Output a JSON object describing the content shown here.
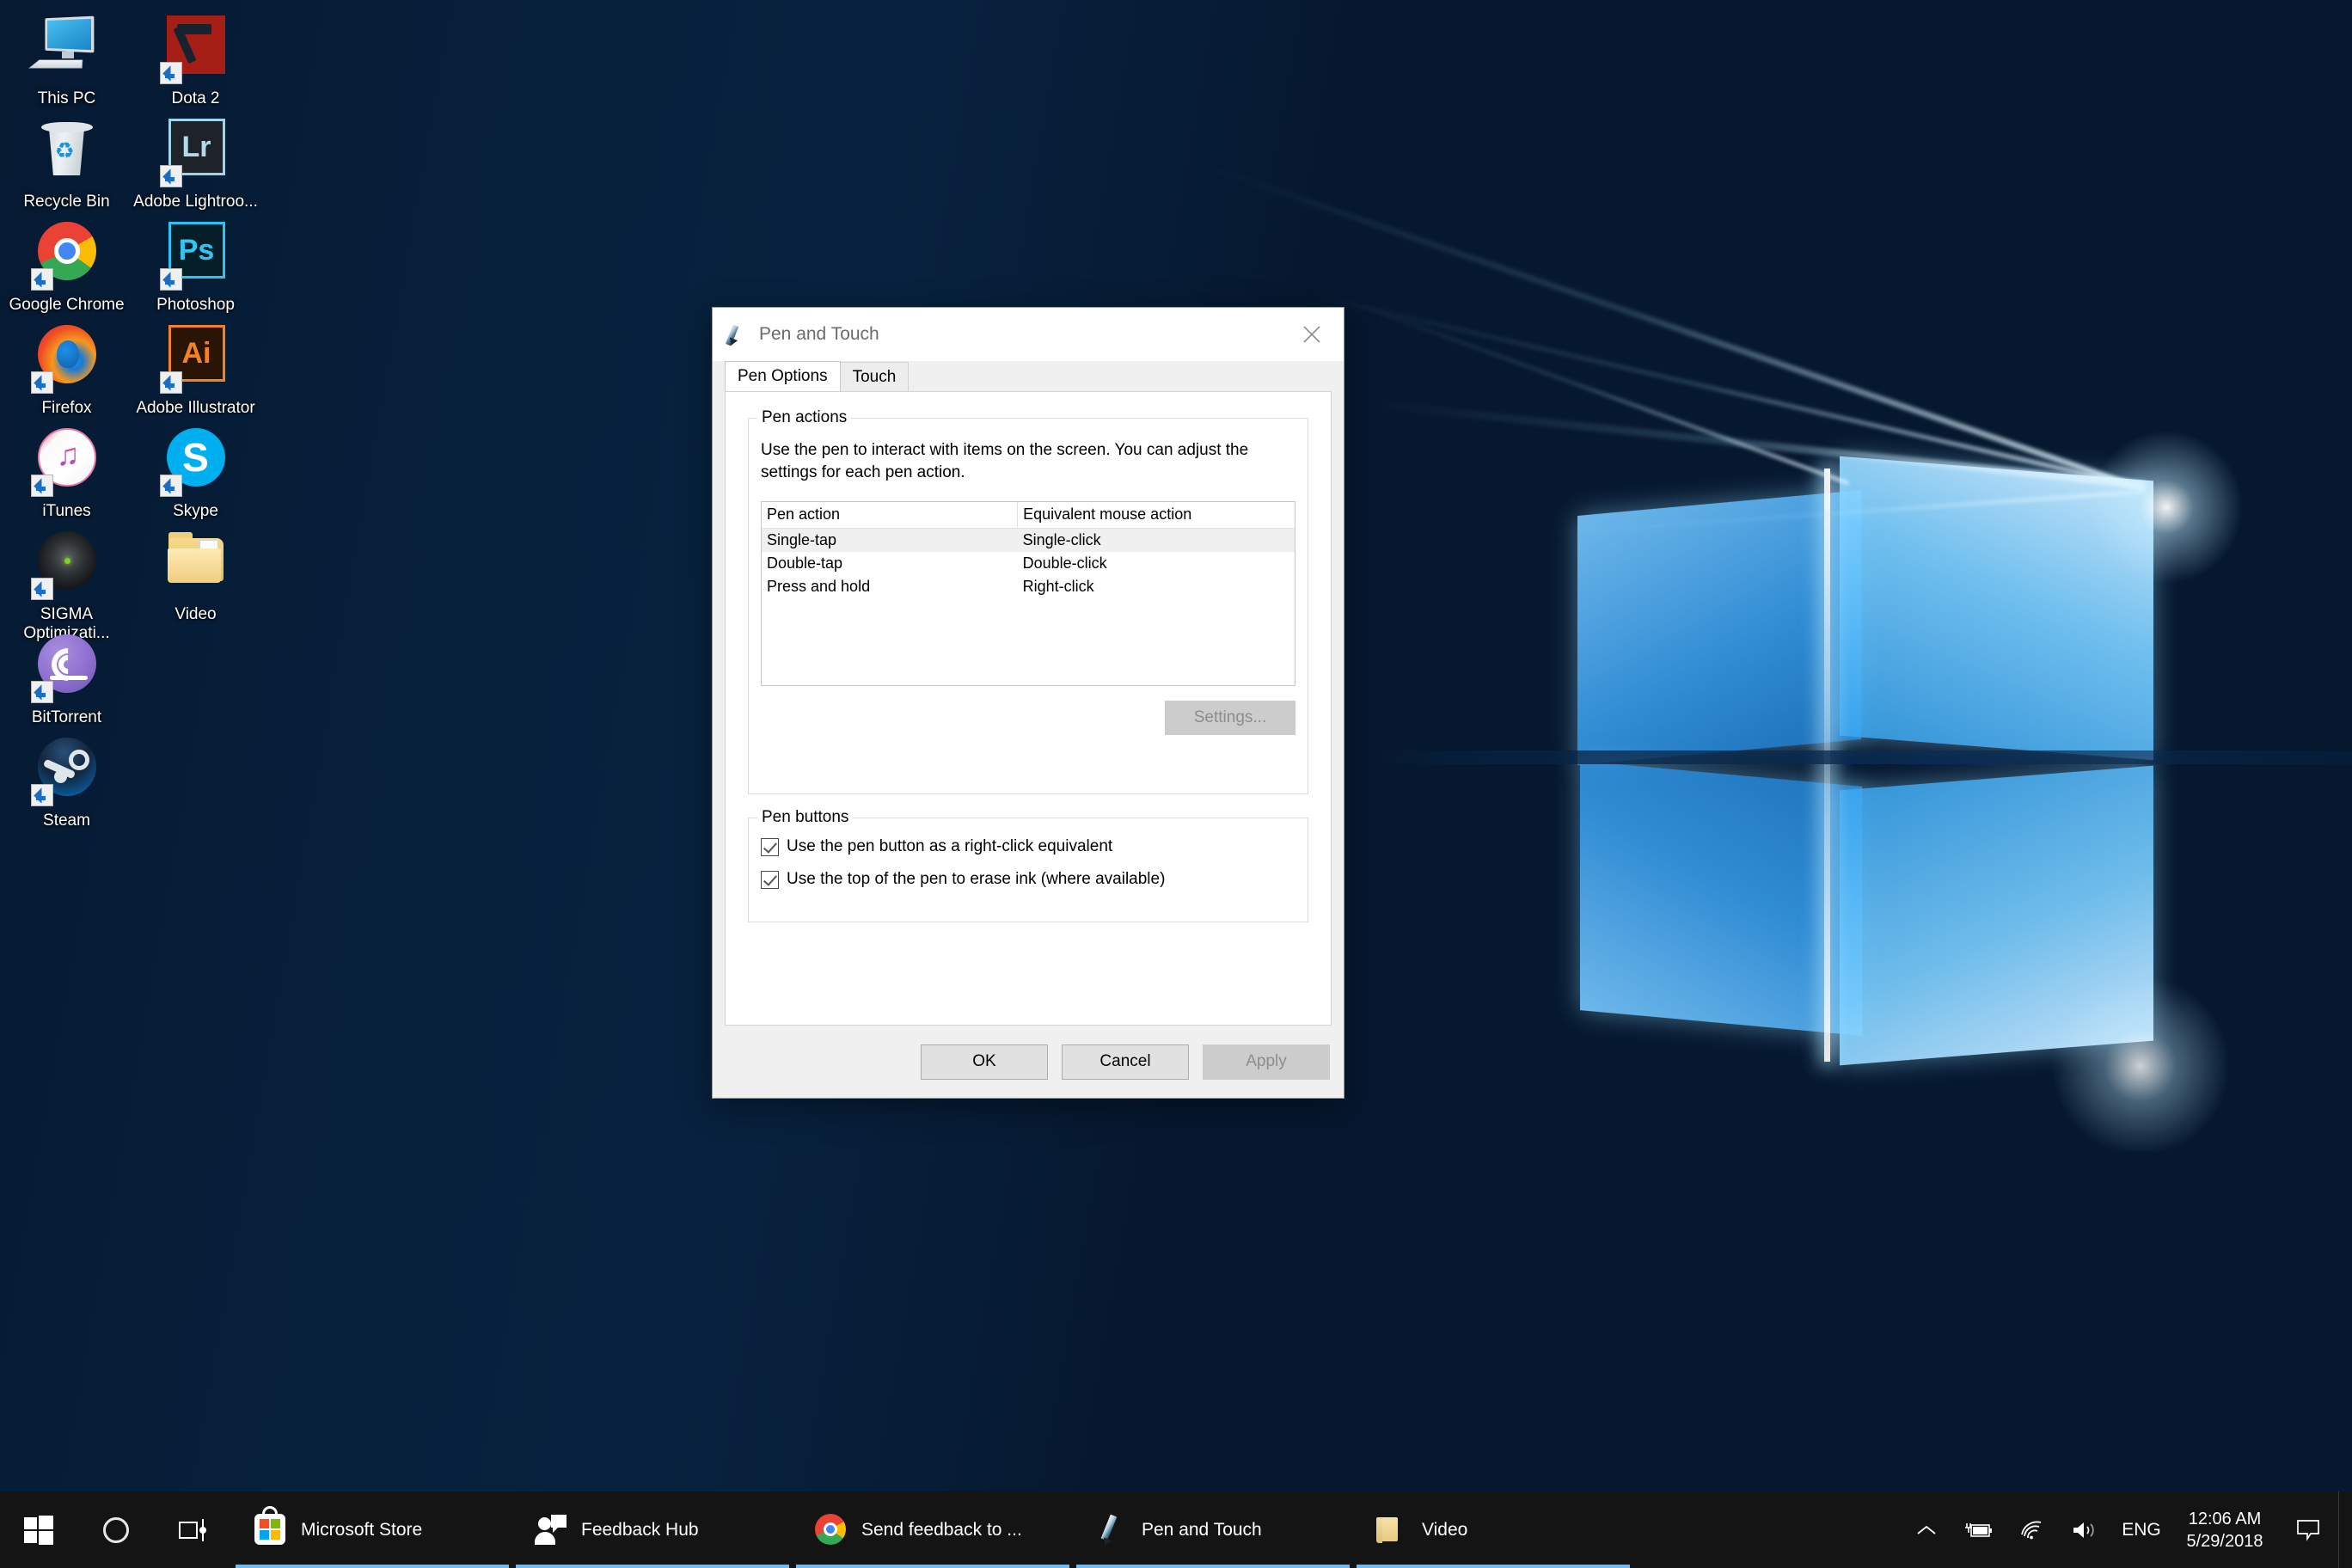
{
  "desktop": {
    "icons": [
      {
        "label": "This PC",
        "icon": "this-pc-icon",
        "shortcut": false
      },
      {
        "label": "Dota 2",
        "icon": "dota-2-icon",
        "shortcut": true
      },
      {
        "label": "Recycle Bin",
        "icon": "recycle-bin-icon",
        "shortcut": false
      },
      {
        "label": "Adobe Lightroo...",
        "icon": "adobe-lightroom-icon",
        "shortcut": true
      },
      {
        "label": "Google Chrome",
        "icon": "google-chrome-icon",
        "shortcut": true
      },
      {
        "label": "Photoshop",
        "icon": "adobe-photoshop-icon",
        "shortcut": true
      },
      {
        "label": "Firefox",
        "icon": "firefox-icon",
        "shortcut": true
      },
      {
        "label": "Adobe Illustrator ...",
        "icon": "adobe-illustrator-icon",
        "shortcut": true
      },
      {
        "label": "iTunes",
        "icon": "itunes-icon",
        "shortcut": true
      },
      {
        "label": "Skype",
        "icon": "skype-icon",
        "shortcut": true
      },
      {
        "label": "SIGMA Optimizati...",
        "icon": "sigma-optimization-icon",
        "shortcut": true
      },
      {
        "label": "Video",
        "icon": "folder-icon",
        "shortcut": false
      },
      {
        "label": "BitTorrent",
        "icon": "bittorrent-icon",
        "shortcut": true
      },
      {
        "label": "Steam",
        "icon": "steam-icon",
        "shortcut": true
      }
    ]
  },
  "dialog": {
    "title": "Pen and Touch",
    "title_icon": "pen-icon",
    "close_icon": "close-icon",
    "tabs": [
      {
        "label": "Pen Options",
        "active": true
      },
      {
        "label": "Touch",
        "active": false
      }
    ],
    "pen_actions": {
      "group_title": "Pen actions",
      "description": "Use the pen to interact with items on the screen.  You can adjust the settings for each pen action.",
      "columns": [
        "Pen action",
        "Equivalent mouse action"
      ],
      "rows": [
        {
          "action": "Single-tap",
          "mouse": "Single-click",
          "selected": true
        },
        {
          "action": "Double-tap",
          "mouse": "Double-click",
          "selected": false
        },
        {
          "action": "Press and hold",
          "mouse": "Right-click",
          "selected": false
        }
      ],
      "settings_button": "Settings...",
      "settings_disabled": true
    },
    "pen_buttons": {
      "group_title": "Pen buttons",
      "checkboxes": [
        {
          "label": "Use the pen button as a right-click equivalent",
          "checked": true
        },
        {
          "label": "Use the top of the pen to erase ink (where available)",
          "checked": true
        }
      ]
    },
    "buttons": [
      {
        "label": "OK",
        "disabled": false
      },
      {
        "label": "Cancel",
        "disabled": false
      },
      {
        "label": "Apply",
        "disabled": true
      }
    ]
  },
  "taskbar": {
    "start_icon": "windows-start-icon",
    "cortana_icon": "cortana-search-icon",
    "taskview_icon": "task-view-icon",
    "apps": [
      {
        "label": "Microsoft Store",
        "icon": "microsoft-store-icon",
        "active": true
      },
      {
        "label": "Feedback Hub",
        "icon": "feedback-hub-icon",
        "active": true
      },
      {
        "label": "Send feedback to ...",
        "icon": "google-chrome-icon",
        "active": true
      },
      {
        "label": "Pen and Touch",
        "icon": "pen-icon",
        "active": true
      },
      {
        "label": "Video",
        "icon": "folder-icon",
        "active": true
      }
    ],
    "tray": {
      "chevron_icon": "show-hidden-icons-chevron-icon",
      "battery_icon": "battery-charging-icon",
      "wifi_icon": "wifi-icon",
      "volume_icon": "volume-icon",
      "language": "ENG",
      "time": "12:06 AM",
      "date": "5/29/2018",
      "action_center_icon": "action-center-icon"
    }
  },
  "colors": {
    "accent": "#76b9ed",
    "taskbar_bg": "#141414",
    "dialog_bg": "#f0f0f0",
    "selection": "#f0f0f0"
  }
}
